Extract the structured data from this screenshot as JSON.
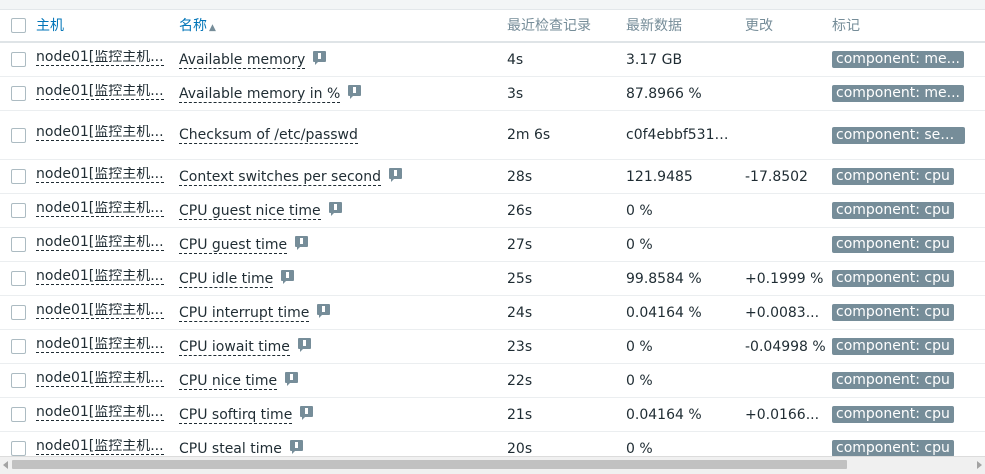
{
  "header": {
    "host": "主机",
    "name": "名称",
    "sort_indicator": "▲",
    "last_check": "最近检查记录",
    "latest_data": "最新数据",
    "change": "更改",
    "tags": "标记"
  },
  "icons": {
    "sort": "sort-ascending-icon",
    "info": "description-icon",
    "checkbox": "checkbox"
  },
  "rows": [
    {
      "host": "node01[监控主机...",
      "name": "Available memory",
      "last_check": "4s",
      "latest": "3.17 GB",
      "change": "",
      "tag": "component: me..."
    },
    {
      "host": "node01[监控主机...",
      "name": "Available memory in %",
      "last_check": "3s",
      "latest": "87.8966 %",
      "change": "",
      "tag": "component: me..."
    },
    {
      "host": "node01[监控主机...",
      "name": "Checksum of /etc/passwd",
      "last_check": "2m 6s",
      "latest": "c0f4ebbf531a...",
      "change": "",
      "tag": "component: sec..."
    },
    {
      "host": "node01[监控主机...",
      "name": "Context switches per second",
      "last_check": "28s",
      "latest": "121.9485",
      "change": "-17.8502",
      "tag": "component: cpu"
    },
    {
      "host": "node01[监控主机...",
      "name": "CPU guest nice time",
      "last_check": "26s",
      "latest": "0 %",
      "change": "",
      "tag": "component: cpu"
    },
    {
      "host": "node01[监控主机...",
      "name": "CPU guest time",
      "last_check": "27s",
      "latest": "0 %",
      "change": "",
      "tag": "component: cpu"
    },
    {
      "host": "node01[监控主机...",
      "name": "CPU idle time",
      "last_check": "25s",
      "latest": "99.8584 %",
      "change": "+0.1999 %",
      "tag": "component: cpu"
    },
    {
      "host": "node01[监控主机...",
      "name": "CPU interrupt time",
      "last_check": "24s",
      "latest": "0.04164 %",
      "change": "+0.0083...",
      "tag": "component: cpu"
    },
    {
      "host": "node01[监控主机...",
      "name": "CPU iowait time",
      "last_check": "23s",
      "latest": "0 %",
      "change": "-0.04998 %",
      "tag": "component: cpu"
    },
    {
      "host": "node01[监控主机...",
      "name": "CPU nice time",
      "last_check": "22s",
      "latest": "0 %",
      "change": "",
      "tag": "component: cpu"
    },
    {
      "host": "node01[监控主机...",
      "name": "CPU softirq time",
      "last_check": "21s",
      "latest": "0.04164 %",
      "change": "+0.0166...",
      "tag": "component: cpu"
    },
    {
      "host": "node01[监控主机...",
      "name": "CPU steal time",
      "last_check": "20s",
      "latest": "0 %",
      "change": "",
      "tag": "component: cpu"
    }
  ]
}
